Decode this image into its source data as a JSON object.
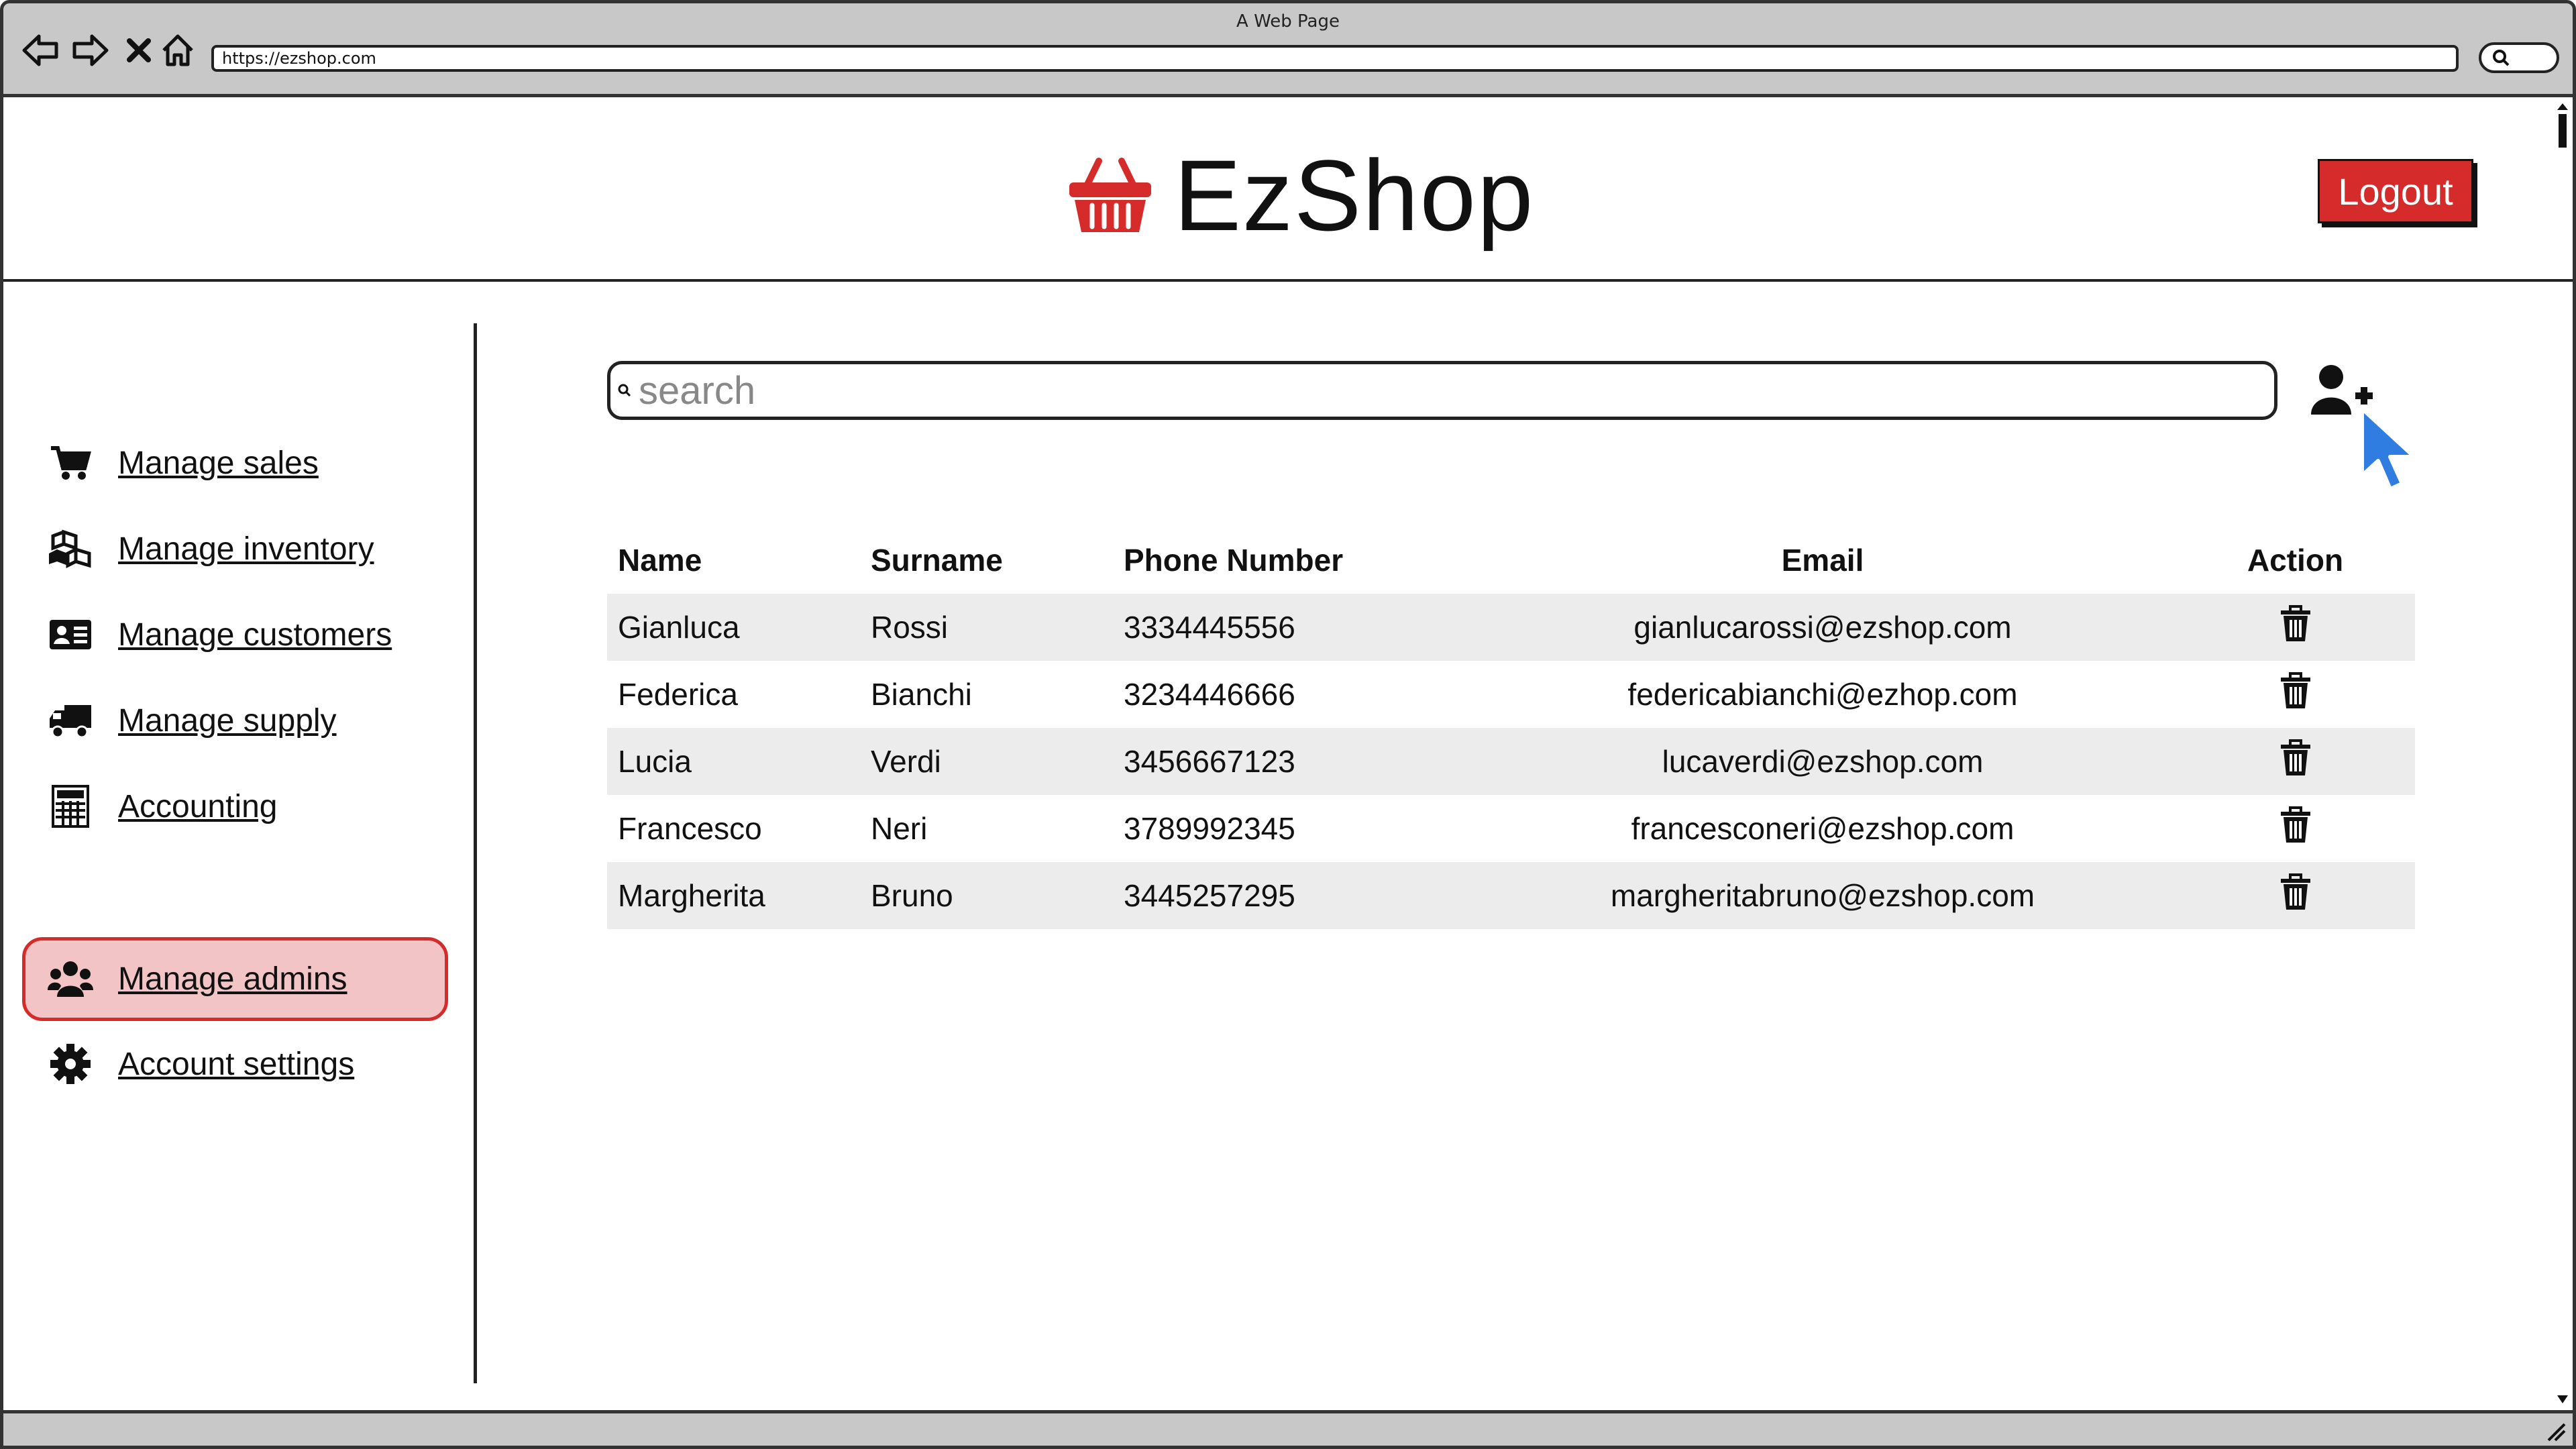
{
  "browser": {
    "window_title": "A Web Page",
    "url": "https://ezshop.com"
  },
  "header": {
    "brand": "EzShop",
    "logout_label": "Logout",
    "brand_color": "#d62b2b"
  },
  "sidebar": {
    "items": [
      {
        "label": "Manage sales",
        "icon": "cart-icon"
      },
      {
        "label": "Manage inventory",
        "icon": "boxes-icon"
      },
      {
        "label": "Manage customers",
        "icon": "id-card-icon"
      },
      {
        "label": "Manage supply",
        "icon": "truck-icon"
      },
      {
        "label": "Accounting",
        "icon": "calculator-icon"
      },
      {
        "label": "Manage admins",
        "icon": "users-icon",
        "active": true
      },
      {
        "label": "Account settings",
        "icon": "gear-icon"
      }
    ],
    "active_bg": "#f2c4c6"
  },
  "main": {
    "search_placeholder": "search",
    "table": {
      "headers": [
        "Name",
        "Surname",
        "Phone Number",
        "Email",
        "Action"
      ],
      "rows": [
        {
          "name": "Gianluca",
          "surname": "Rossi",
          "phone": "3334445556",
          "email": "gianlucarossi@ezshop.com"
        },
        {
          "name": "Federica",
          "surname": "Bianchi",
          "phone": "3234446666",
          "email": "federicabianchi@ezhop.com"
        },
        {
          "name": "Lucia",
          "surname": "Verdi",
          "phone": "3456667123",
          "email": "lucaverdi@ezshop.com"
        },
        {
          "name": "Francesco",
          "surname": "Neri",
          "phone": "3789992345",
          "email": "francesconeri@ezshop.com"
        },
        {
          "name": "Margherita",
          "surname": "Bruno",
          "phone": "3445257295",
          "email": "margheritabruno@ezshop.com"
        }
      ]
    }
  }
}
